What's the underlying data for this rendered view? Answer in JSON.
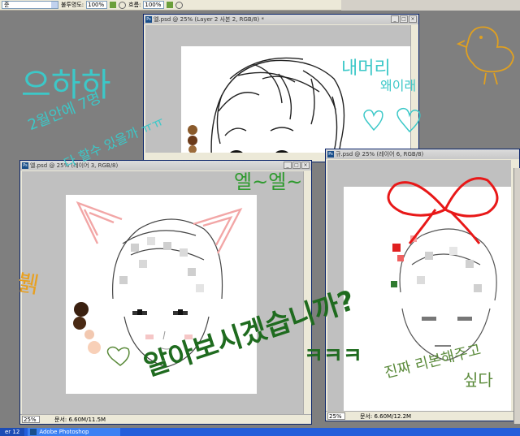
{
  "options_bar": {
    "mode_value": "준",
    "opacity_label": "불투명도:",
    "opacity_value": "100%",
    "flow_label": "흐름:",
    "flow_value": "100%"
  },
  "windows": [
    {
      "title": "엘.psd @ 25% (Layer 2 사본 2, RGB/8) *"
    },
    {
      "title": "엘.psd @ 25% (레이어 3, RGB/8)",
      "zoom": "25%",
      "docsize": "문서: 6.60M/11.5M"
    },
    {
      "title": "규.psd @ 25% (레이어 6, RGB/8)",
      "zoom": "25%",
      "docsize": "문서: 6.60M/12.2M"
    }
  ],
  "window_controls": [
    "_",
    "□",
    "×"
  ],
  "doodles": {
    "t1": "으하하",
    "t2": "2월안에 7명",
    "t3": "다 할수 있을까 ㅠㅠ",
    "t4": "내머리",
    "t5": "왜이래",
    "t6": "엘~엘~",
    "t7": "뷁",
    "t8": "알아보시겠습니까?",
    "t9": "ㅋㅋㅋ",
    "t10": "진짜 리본해주고",
    "t11": "싶다"
  },
  "taskbar": {
    "item1": "er 12",
    "item2": "Adobe Photoshop"
  },
  "colors": {
    "cyan_ink": "#3cc8c8",
    "green_ink": "#1f6b1f",
    "olive_ink": "#5a8a3a",
    "orange_ink": "#e8a020",
    "red_ribbon": "#e81818",
    "pink_ears": "#f2a6a6",
    "workspace": "#7f7f7f"
  }
}
